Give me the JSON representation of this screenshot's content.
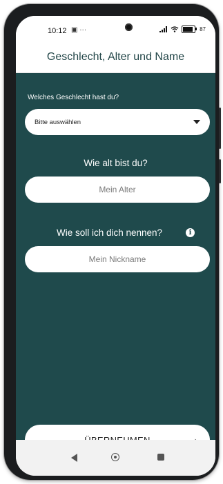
{
  "status_bar": {
    "time": "10:12",
    "left_icons": "▣ ···",
    "battery_level": 0.87,
    "battery_text": "87"
  },
  "header": {
    "title": "Geschlecht, Alter und Name"
  },
  "form": {
    "gender_label": "Welches Geschlecht hast du?",
    "gender_select_value": "Bitte auswählen",
    "age_heading": "Wie alt bist du?",
    "age_placeholder": "Mein Alter",
    "name_heading": "Wie soll ich dich nennen?",
    "name_placeholder": "Mein Nickname",
    "info_icon": "info-icon"
  },
  "actions": {
    "submit_label": "ÜBERNEHMEN",
    "submit_arrow": "→"
  },
  "colors": {
    "background": "#1f4a4c",
    "header_text": "#25484a"
  }
}
